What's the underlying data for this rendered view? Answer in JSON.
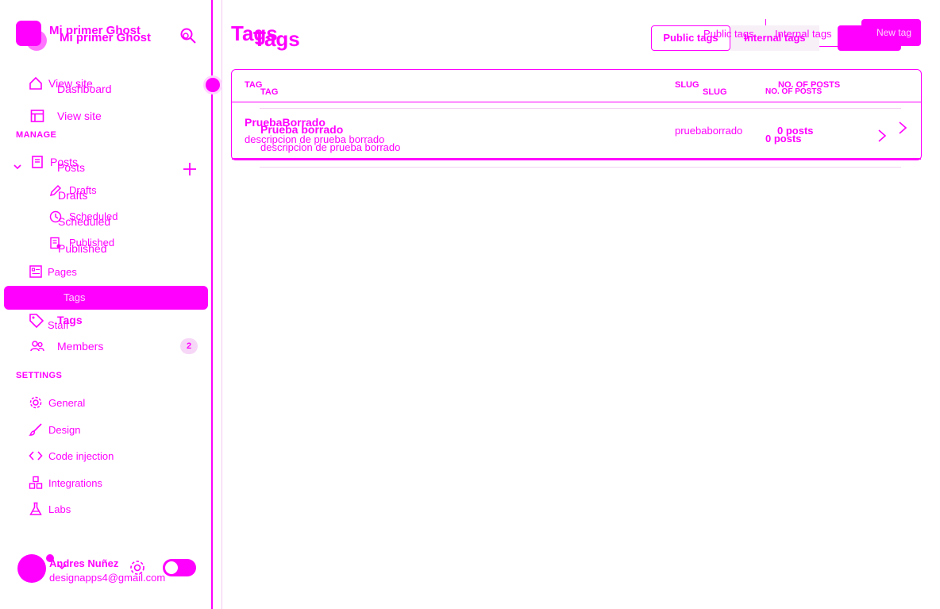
{
  "brand": {
    "title": "Mi primer Ghost"
  },
  "nav": {
    "dashboard": "Dashboard",
    "view_site": "View site",
    "posts": "Posts",
    "drafts": "Drafts",
    "scheduled": "Scheduled",
    "published": "Published",
    "pages": "Pages",
    "tags": "Tags",
    "staff": "Staff",
    "members": "Members",
    "members_count": "2"
  },
  "sections": {
    "manage": "MANAGE",
    "settings": "SETTINGS"
  },
  "settings": {
    "general": "General",
    "design": "Design",
    "code_injection": "Code injection",
    "integrations": "Integrations",
    "labs": "Labs"
  },
  "user": {
    "name": "Andres Nuñez",
    "email": "designapps4@gmail.com"
  },
  "main": {
    "title": "Tags",
    "tabs": {
      "public": "Public tags",
      "internal": "Internal tags"
    },
    "new_tag": "New tag"
  },
  "table": {
    "headers": {
      "tag": "TAG",
      "slug": "SLUG",
      "posts": "NO. OF POSTS"
    },
    "rows": [
      {
        "name": "Prueba borrado",
        "name_ghost": "PruebaBorrado",
        "description": "descripcion de prueba borrado",
        "slug": "pruebaborrado",
        "posts": "0 posts"
      }
    ]
  },
  "colors": {
    "accent": "#ff00ff"
  }
}
